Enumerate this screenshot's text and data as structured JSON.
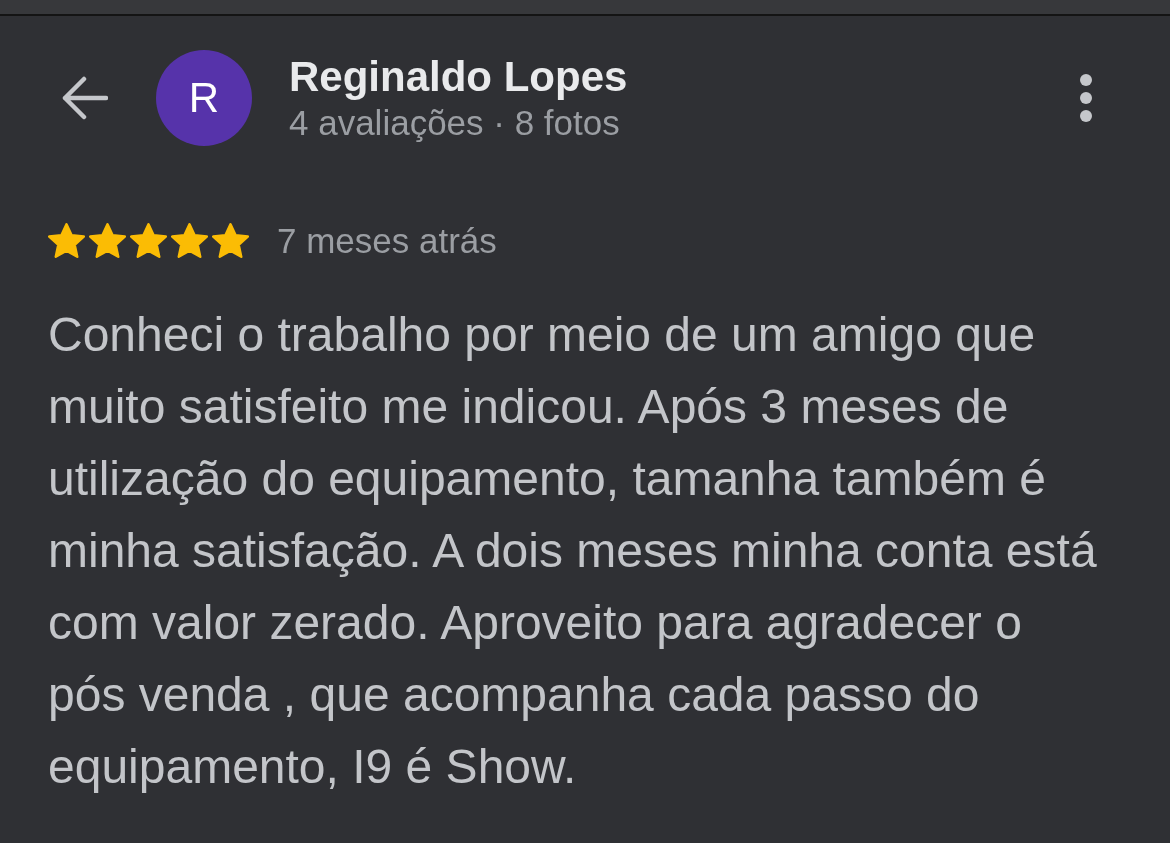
{
  "reviewer": {
    "initial": "R",
    "name": "Reginaldo Lopes",
    "stats": "4 avaliações · 8 fotos"
  },
  "review": {
    "stars": 5,
    "time": "7 meses atrás",
    "text": "Conheci o trabalho por meio de um amigo que muito satisfeito me indicou. Após 3 meses de utilização do equipamento, tamanha também é minha satisfação. A dois meses minha conta está com valor zerado. Aproveito para agradecer o pós venda , que acompanha cada passo do equipamento, I9 é Show."
  }
}
